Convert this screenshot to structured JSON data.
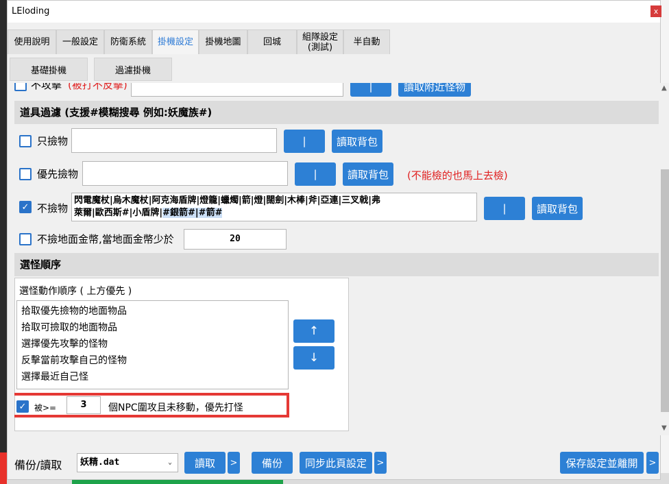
{
  "window": {
    "title": "LEloding",
    "close_glyph": "x"
  },
  "tabs": [
    {
      "label": "使用說明"
    },
    {
      "label": "一般設定"
    },
    {
      "label": "防衛系統"
    },
    {
      "label": "掛機設定",
      "active": true
    },
    {
      "label": "掛機地圖"
    },
    {
      "label": "回城"
    },
    {
      "label": "組隊設定\n(測試)"
    },
    {
      "label": "半自動"
    }
  ],
  "subtabs": [
    "基礎掛機",
    "過濾掛機"
  ],
  "top_partial": {
    "checkbox_label": "不攻擊",
    "note": "(被打不反擊)",
    "sep_button": "|",
    "read_button": "讀取附近怪物"
  },
  "item_filter": {
    "heading": "道具過濾 (支援#模糊搜尋 例如:妖魔族#)",
    "rows": [
      {
        "label": "只撿物",
        "checked": false,
        "value": "",
        "sep_button": "|",
        "read_button": "讀取背包"
      },
      {
        "label": "優先撿物",
        "checked": false,
        "value": "",
        "sep_button": "|",
        "read_button": "讀取背包",
        "note": "(不能檢的也馬上去檢)"
      },
      {
        "label": "不撿物",
        "checked": true,
        "value_line1": "閃電魔杖|烏木魔杖|阿克海盾牌|燈籠|蠟燭|箭|燈|闊劍|木棒|斧|亞連|三叉戟|弗",
        "value_line2": "萊爾|歐西斯#|小盾牌|",
        "value_highlight": "#銀箭#|#箭#",
        "sep_button": "|",
        "read_button": "讀取背包"
      }
    ],
    "gold": {
      "label": "不撿地面金幣,當地面金幣少於",
      "checked": false,
      "value": "20"
    }
  },
  "monster_order": {
    "heading": "選怪順序",
    "group_title": "選怪動作順序 ( 上方優先 )",
    "items": [
      "拾取優先撿物的地面物品",
      "拾取可撿取的地面物品",
      "選擇優先攻擊的怪物",
      "反擊當前攻擊自己的怪物",
      "選擇最近自己怪"
    ],
    "up_glyph": "↑",
    "down_glyph": "↓",
    "npc_rule": {
      "checked": true,
      "prefix": "被>=",
      "count": "3",
      "text": "個NPC圍攻且未移動，優先打怪"
    }
  },
  "bottom": {
    "label": "備份/讀取",
    "file_value": "妖精.dat",
    "read_button": "讀取",
    "more_glyph": ">",
    "backup_button": "備份",
    "sync_button": "同步此頁設定",
    "save_exit_button": "保存設定並離開"
  },
  "colors": {
    "accent": "#2d80d5",
    "warning": "#e02020",
    "highlight_box": "#e53935",
    "active_tab_text": "#2e7bd6"
  }
}
